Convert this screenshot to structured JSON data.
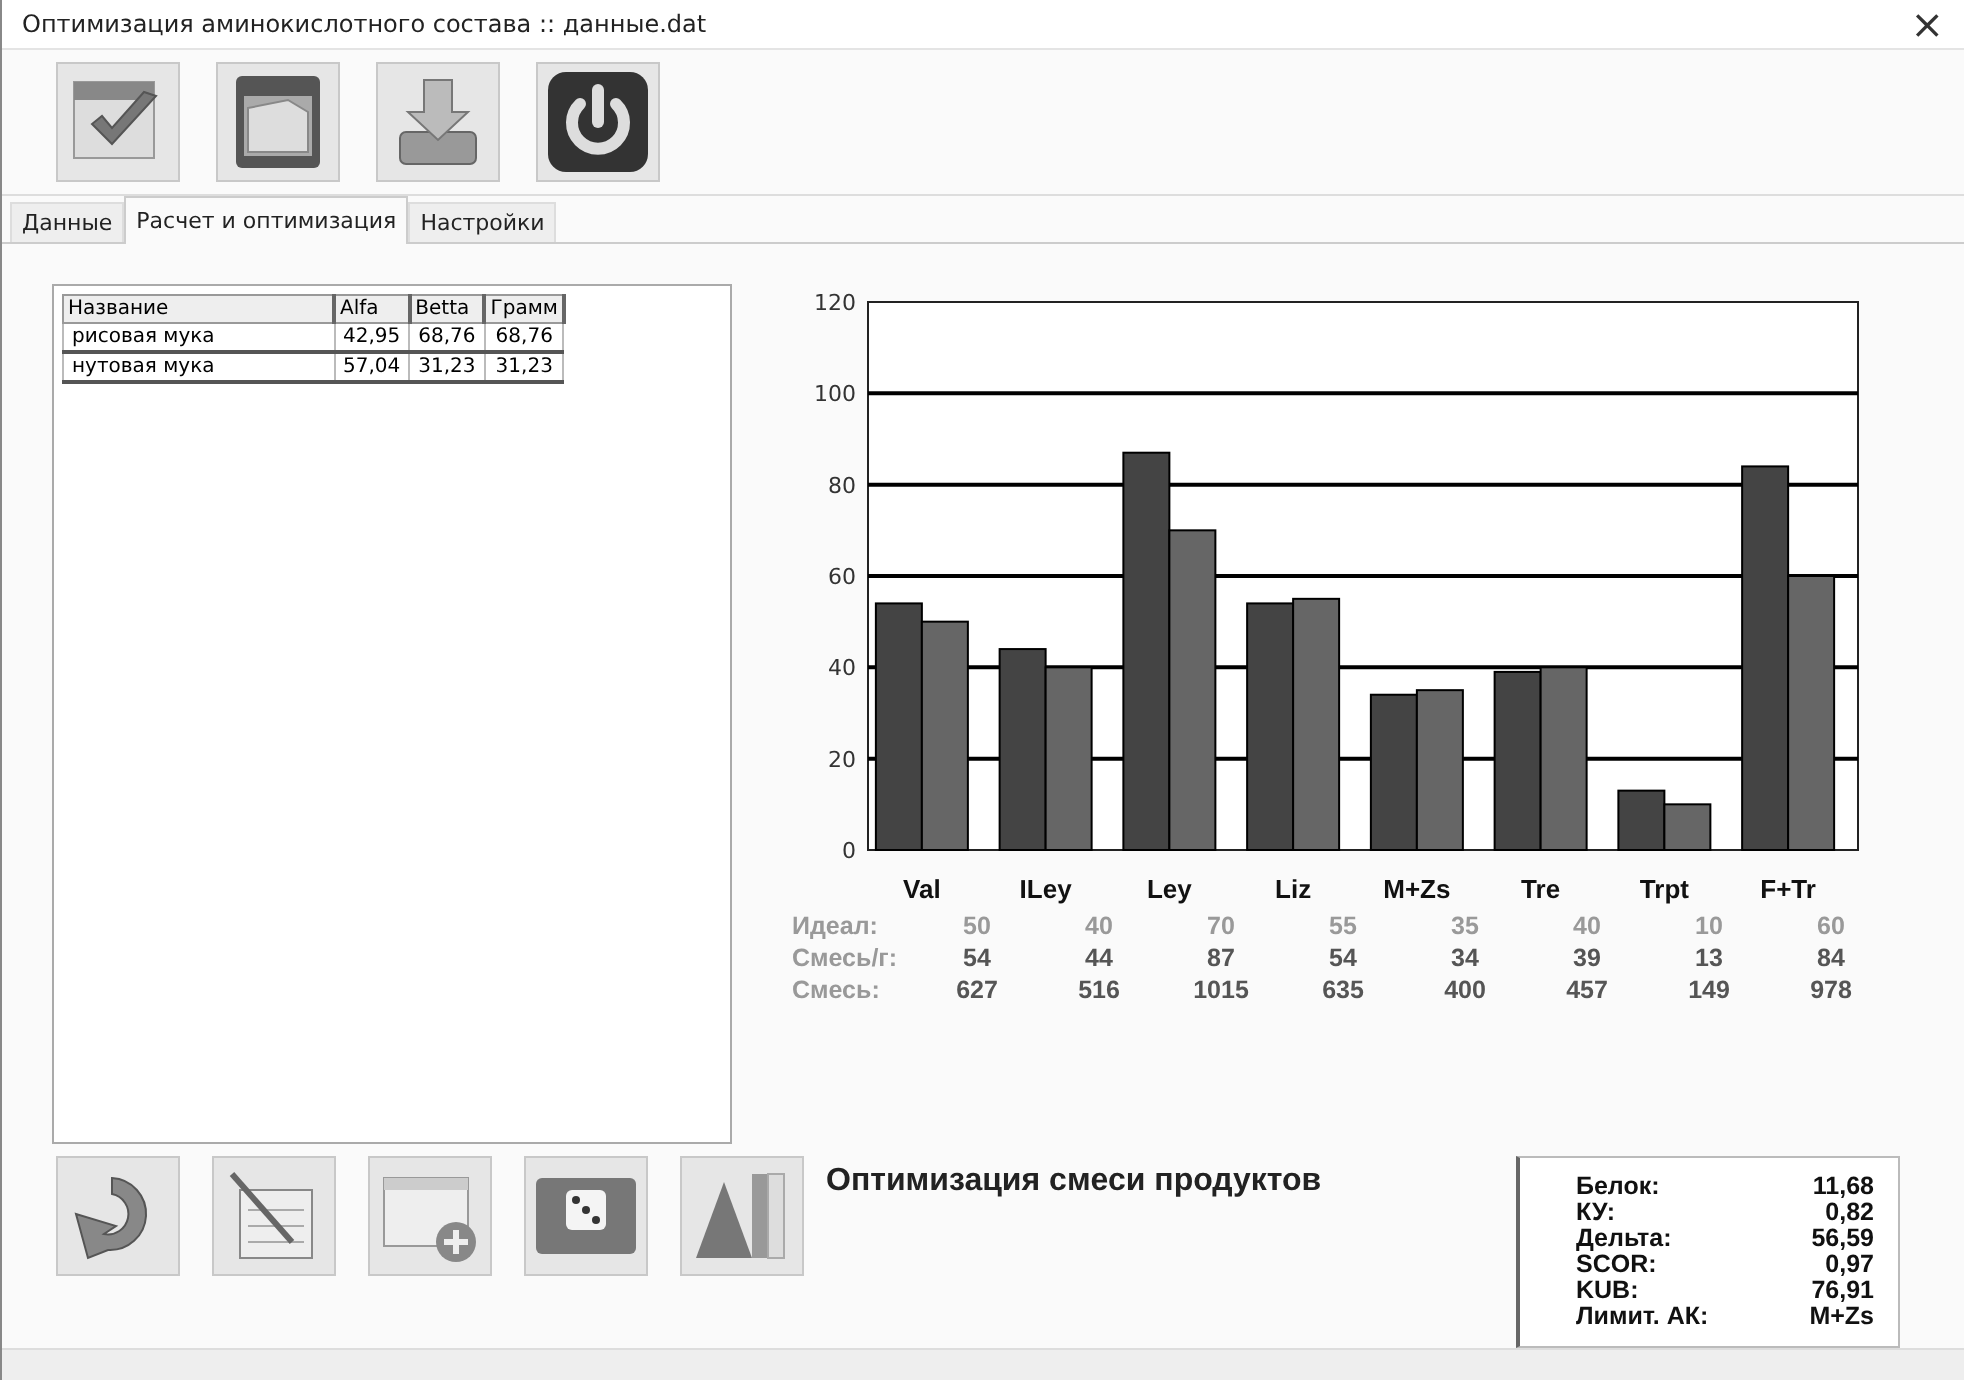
{
  "window": {
    "title": "Оптимизация аминокислотного состава :: данные.dat",
    "close": "×"
  },
  "toolbar": [
    {
      "kind": "calendar"
    },
    {
      "kind": "drawer"
    },
    {
      "kind": "download"
    },
    {
      "kind": "power"
    }
  ],
  "tabs": [
    {
      "label": "Данные",
      "selected": false
    },
    {
      "label": "Расчет и оптимизация",
      "selected": true
    },
    {
      "label": "Настройки",
      "selected": false
    }
  ],
  "table": {
    "columns": [
      "Название",
      "Alfa",
      "Betta",
      "Грамм"
    ],
    "rows": [
      {
        "cells": [
          "рисовая мука",
          "42,95",
          "68,76",
          "68,76"
        ]
      },
      {
        "cells": [
          "нутовая мука",
          "57,04",
          "31,23",
          "31,23"
        ]
      }
    ]
  },
  "chart": {
    "chart_data": {
      "type": "bar",
      "categories": [
        "Val",
        "ILey",
        "Ley",
        "Liz",
        "M+Zs",
        "Tre",
        "Trpt",
        "F+Tr"
      ],
      "ylim": [
        0,
        120
      ],
      "grid": true,
      "yticks": [
        0,
        20,
        40,
        60,
        80,
        100,
        120
      ],
      "series": [
        {
          "color": "#444444",
          "values": [
            54,
            44,
            87,
            54,
            34,
            39,
            13,
            84
          ]
        },
        {
          "color": "#666666",
          "values": [
            50,
            40,
            70,
            55,
            35,
            40,
            10,
            60
          ]
        }
      ]
    }
  },
  "value_rows": [
    {
      "label": "Идеал:",
      "muted": true,
      "values": [
        "50",
        "40",
        "70",
        "55",
        "35",
        "40",
        "10",
        "60"
      ]
    },
    {
      "label": "Смесь/г:",
      "muted": false,
      "values": [
        "54",
        "44",
        "87",
        "54",
        "34",
        "39",
        "13",
        "84"
      ]
    },
    {
      "label": "Смесь:",
      "muted": false,
      "values": [
        "627",
        "516",
        "1015",
        "635",
        "400",
        "457",
        "149",
        "978"
      ]
    }
  ],
  "chart_title": "Оптимизация смеси продуктов",
  "stats": [
    {
      "label": "Белок:",
      "value": "11,68"
    },
    {
      "label": "КУ:",
      "value": "0,82"
    },
    {
      "label": "Дельта:",
      "value": "56,59"
    },
    {
      "label": "SCOR:",
      "value": "0,97"
    },
    {
      "label": "KUB:",
      "value": "76,91"
    },
    {
      "label": "Лимит. АК:",
      "value": "M+Zs"
    }
  ],
  "bottom_toolbar": [
    {
      "kind": "curved-arrow"
    },
    {
      "kind": "notepad"
    },
    {
      "kind": "window-plus"
    },
    {
      "kind": "dice"
    },
    {
      "kind": "pyramid"
    }
  ]
}
